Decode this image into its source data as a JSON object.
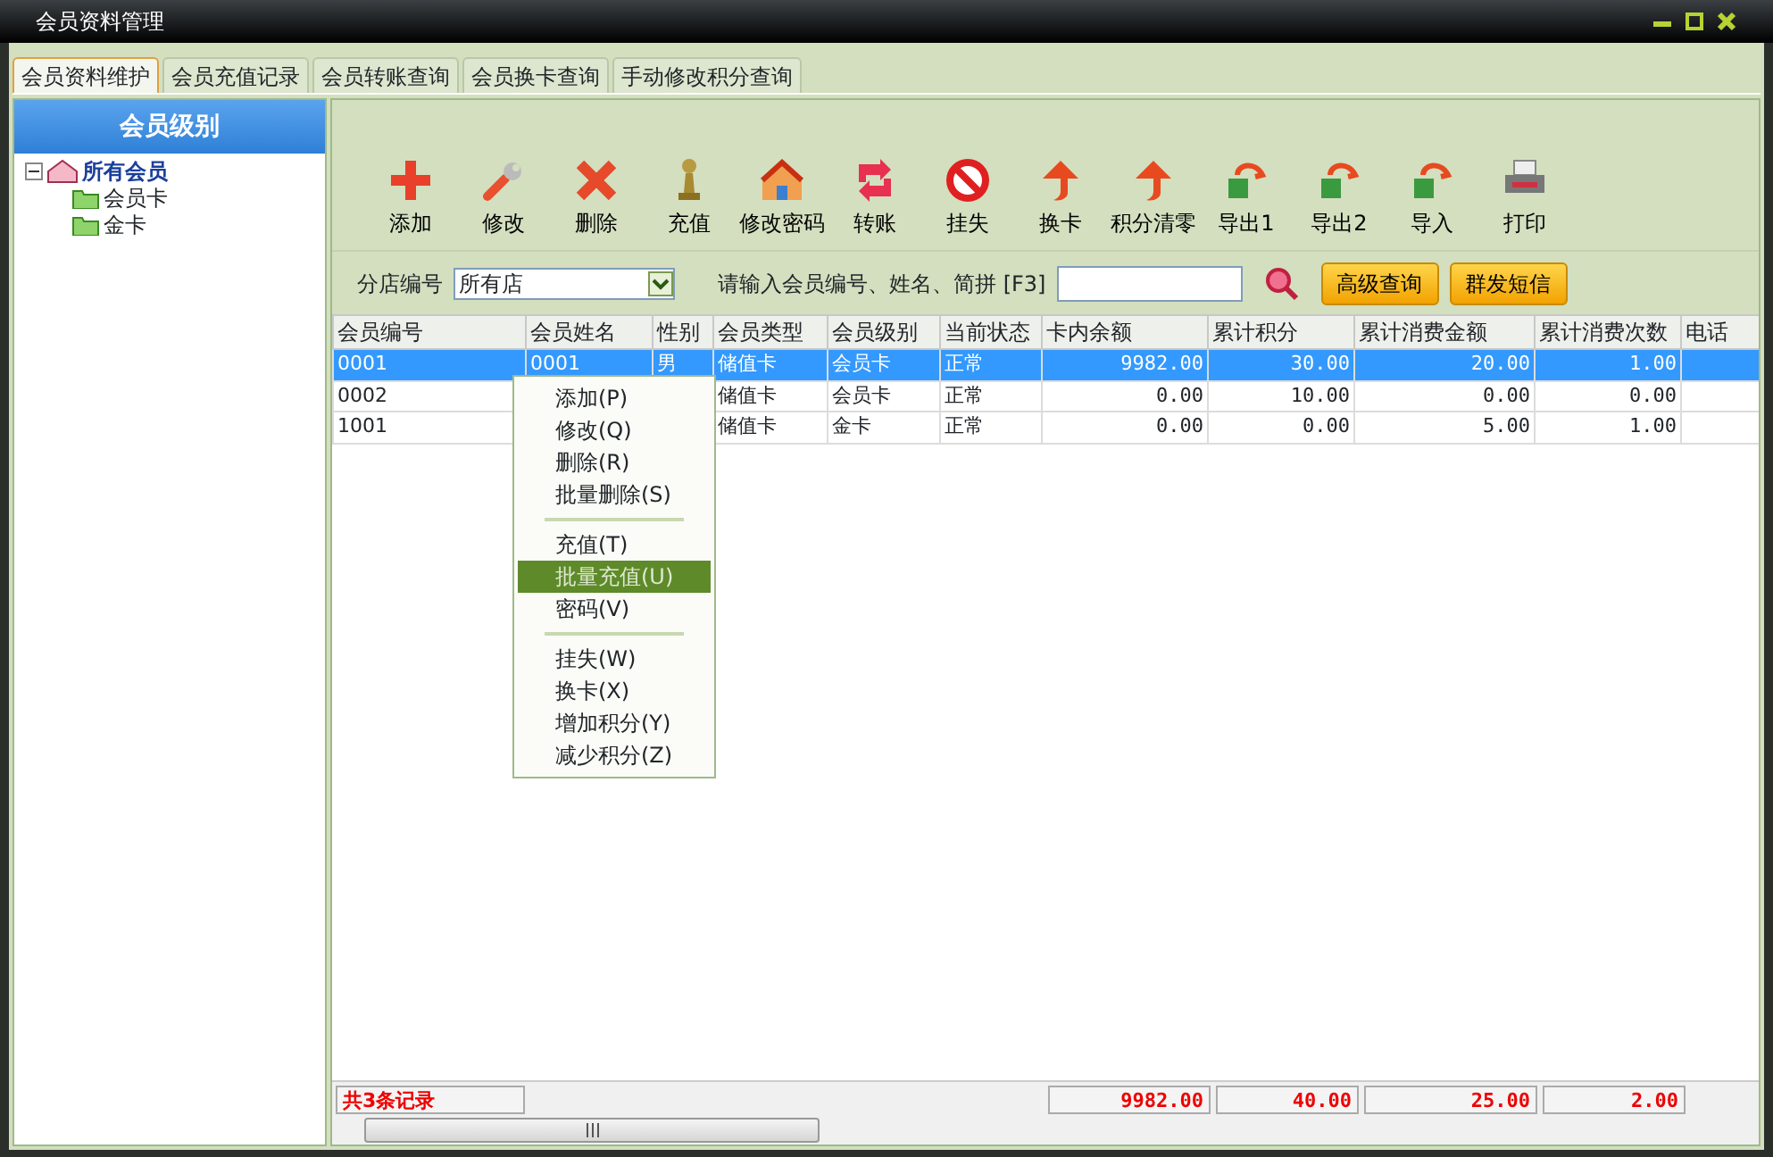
{
  "window": {
    "title": "会员资料管理"
  },
  "tabs": [
    {
      "label": "会员资料维护",
      "selected": true
    },
    {
      "label": "会员充值记录",
      "selected": false
    },
    {
      "label": "会员转账查询",
      "selected": false
    },
    {
      "label": "会员换卡查询",
      "selected": false
    },
    {
      "label": "手动修改积分查询",
      "selected": false
    }
  ],
  "sidebar": {
    "title": "会员级别",
    "tree": [
      {
        "label": "所有会员",
        "expanded": true,
        "children": [
          {
            "label": "会员卡"
          },
          {
            "label": "金卡"
          }
        ]
      }
    ]
  },
  "toolbar": [
    "添加",
    "修改",
    "删除",
    "充值",
    "修改密码",
    "转账",
    "挂失",
    "换卡",
    "积分清零",
    "导出1",
    "导出2",
    "导入",
    "打印"
  ],
  "filter": {
    "store_label": "分店编号",
    "store_value": "所有店",
    "search_label": "请输入会员编号、姓名、简拼 [F3]",
    "buttons": [
      "高级查询",
      "群发短信"
    ]
  },
  "table": {
    "columns": [
      "会员编号",
      "会员姓名",
      "性别",
      "会员类型",
      "会员级别",
      "当前状态",
      "卡内余额",
      "累计积分",
      "累计消费金额",
      "累计消费次数",
      "电话"
    ],
    "rows": [
      {
        "selected": true,
        "cells": [
          "0001",
          "0001",
          "男",
          "储值卡",
          "会员卡",
          "正常",
          "9982.00",
          "30.00",
          "20.00",
          "1.00",
          null
        ]
      },
      {
        "selected": false,
        "cells": [
          "0002",
          null,
          null,
          "储值卡",
          "会员卡",
          "正常",
          "0.00",
          "10.00",
          "0.00",
          "0.00",
          null
        ]
      },
      {
        "selected": false,
        "cells": [
          "1001",
          null,
          null,
          "储值卡",
          "金卡",
          "正常",
          "0.00",
          "0.00",
          "5.00",
          "1.00",
          null
        ]
      }
    ]
  },
  "context_menu": [
    {
      "kind": "item",
      "label": "添加(P)",
      "selected": false
    },
    {
      "kind": "item",
      "label": "修改(Q)",
      "selected": false
    },
    {
      "kind": "item",
      "label": "删除(R)",
      "selected": false
    },
    {
      "kind": "item",
      "label": "批量删除(S)",
      "selected": false
    },
    {
      "kind": "separator"
    },
    {
      "kind": "item",
      "label": "充值(T)",
      "selected": false
    },
    {
      "kind": "item",
      "label": "批量充值(U)",
      "selected": true
    },
    {
      "kind": "item",
      "label": "密码(V)",
      "selected": false
    },
    {
      "kind": "separator"
    },
    {
      "kind": "item",
      "label": "挂失(W)",
      "selected": false
    },
    {
      "kind": "item",
      "label": "换卡(X)",
      "selected": false
    },
    {
      "kind": "item",
      "label": "增加积分(Y)",
      "selected": false
    },
    {
      "kind": "item",
      "label": "减少积分(Z)",
      "selected": false
    }
  ],
  "footer": {
    "count": "共3条记录",
    "totals": [
      "9982.00",
      "40.00",
      "25.00",
      "2.00"
    ]
  }
}
